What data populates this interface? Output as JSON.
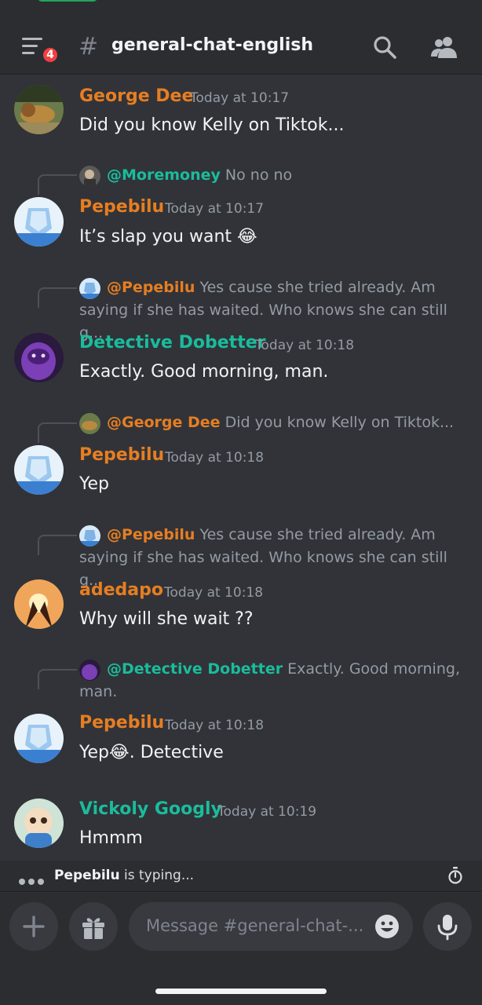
{
  "header": {
    "badge_count": "4",
    "hash": "#",
    "channel_name": "general-chat-english"
  },
  "messages": [
    {
      "author": "George Dee",
      "time": "Today at 10:17",
      "text": "Did you know Kelly on Tiktok..."
    },
    {
      "reply": {
        "mention": "@Moremoney",
        "text": "No no no"
      },
      "author": "Pepebilu",
      "time": "Today at 10:17",
      "text": "It’s slap you want 😂"
    },
    {
      "reply": {
        "mention": "@Pepebilu",
        "text": "Yes cause she tried already. Am saying if she has waited. Who knows she can still g..."
      },
      "author": "Detective Dobetter",
      "time": "Today at 10:18",
      "text": "Exactly. Good morning, man."
    },
    {
      "reply": {
        "mention": "@George Dee",
        "text": "Did you know Kelly on Tiktok..."
      },
      "author": "Pepebilu",
      "time": "Today at 10:18",
      "text": "Yep"
    },
    {
      "reply": {
        "mention": "@Pepebilu",
        "text": "Yes cause she tried already. Am saying if she has waited. Who knows she can still g..."
      },
      "author": "adedapo",
      "time": "Today at 10:18",
      "text": "Why will she wait ??"
    },
    {
      "reply": {
        "mention": "@Detective Dobetter",
        "text": "Exactly. Good morning, man."
      },
      "author": "Pepebilu",
      "time": "Today at 10:18",
      "text": "Yep😂. Detective"
    },
    {
      "author": "Vickoly Googly",
      "time": "Today at 10:19",
      "text": "Hmmm"
    }
  ],
  "typing": {
    "user": "Pepebilu",
    "suffix": " is typing..."
  },
  "composer": {
    "placeholder": "Message #general-chat-..."
  },
  "icons": [
    "menu-icon",
    "search-icon",
    "members-icon",
    "timer-icon",
    "plus-icon",
    "gift-icon",
    "emoji-icon",
    "microphone-icon"
  ],
  "colors": {
    "accent_orange": "#e67e22",
    "accent_teal": "#1abc9c",
    "badge_red": "#f23f42",
    "online_green": "#23a55a"
  }
}
